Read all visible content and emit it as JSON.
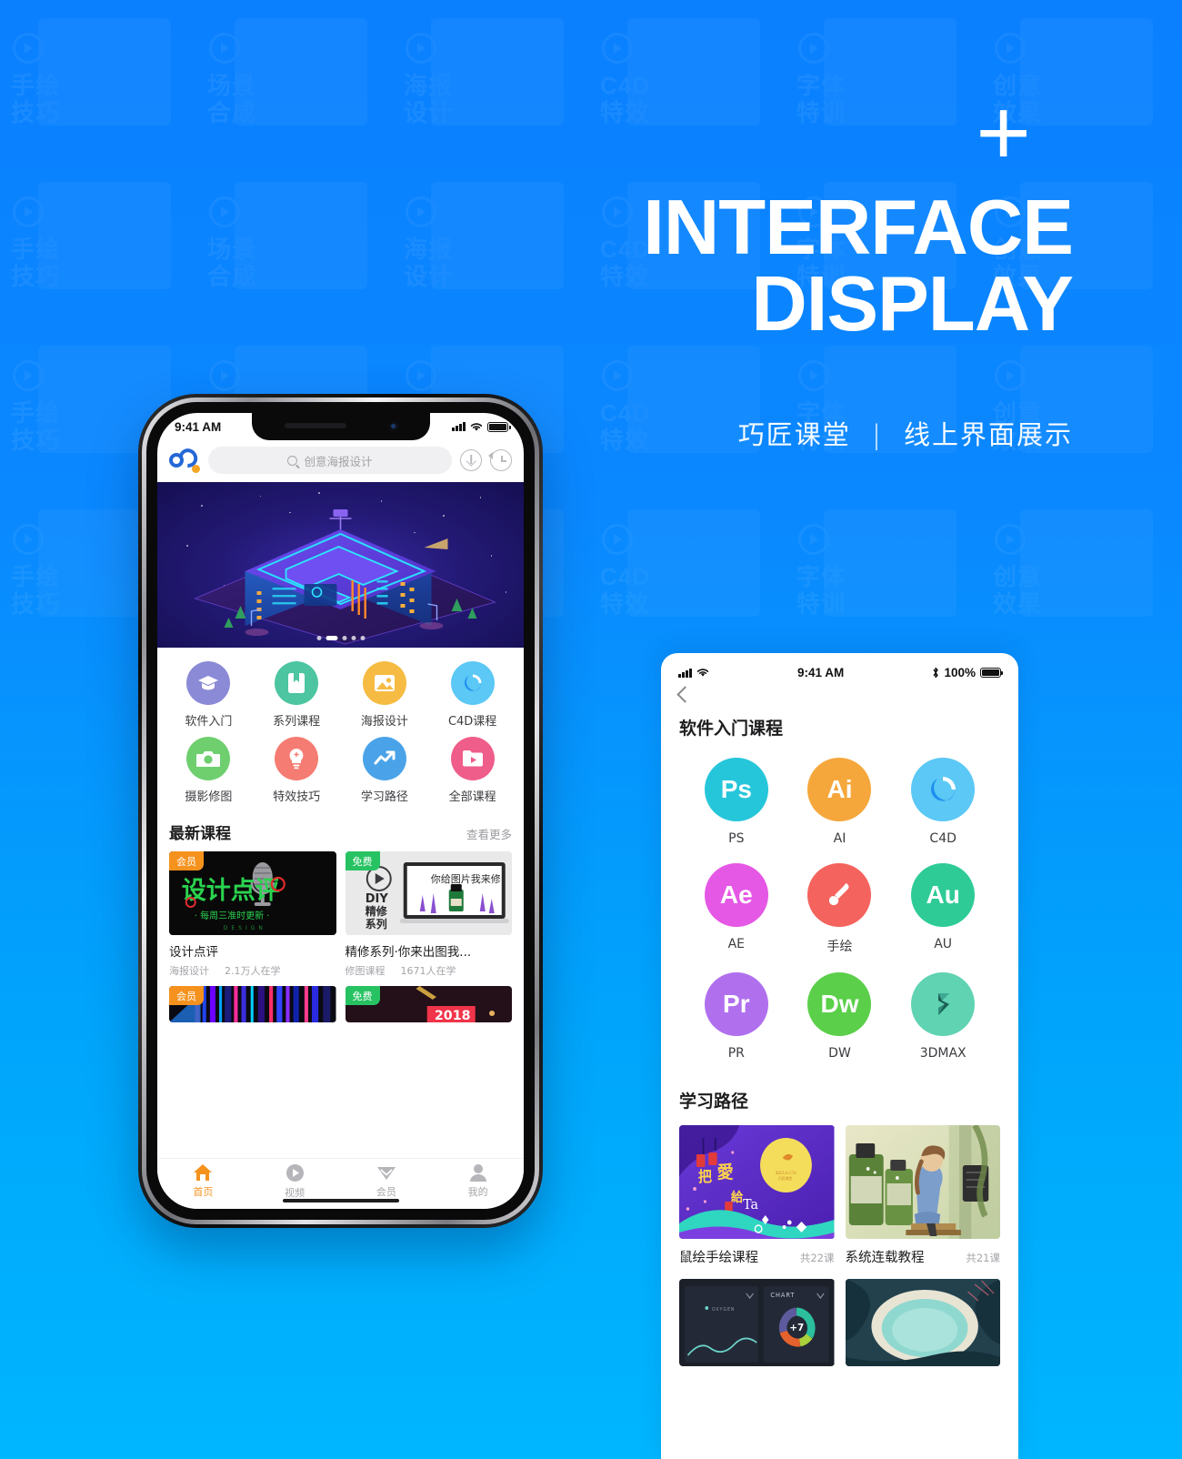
{
  "hero": {
    "plus": "+",
    "line1": "INTERFACE",
    "line2": "DISPLAY",
    "subtitle_left": "巧匠课堂",
    "subtitle_bar": "|",
    "subtitle_right": "线上界面展示"
  },
  "colors": {
    "bg_top": "#0a80ff",
    "bg_bottom": "#00b6ff",
    "accent_orange": "#f5921e",
    "accent_green": "#27c262",
    "brand_blue": "#2468d6"
  },
  "watermark_words": [
    "手绘\n技巧",
    "场景\n合成",
    "海报\n设计",
    "C4D\n特效",
    "字体\n特训",
    "创意\n效果"
  ],
  "left_phone": {
    "status": {
      "time": "9:41 AM",
      "signal": "signal-bars",
      "wifi": "wifi-icon",
      "battery": "battery-icon"
    },
    "appbar": {
      "logo": "qiaojiang-logo",
      "search_placeholder": "创意海报设计",
      "search_icon": "search-icon",
      "download_icon": "download-icon",
      "history_icon": "history-icon"
    },
    "banner": {
      "alt": "isometric-neon-building",
      "dot_count": 5,
      "active_dot": 1
    },
    "categories": [
      {
        "label": "软件入门",
        "icon": "graduation-cap-icon",
        "color": "#8b8ad6"
      },
      {
        "label": "系列课程",
        "icon": "bookmark-book-icon",
        "color": "#4cc5a0"
      },
      {
        "label": "海报设计",
        "icon": "image-icon",
        "color": "#f6bb42"
      },
      {
        "label": "C4D课程",
        "icon": "c4d-icon",
        "color": "#5bc8f5"
      },
      {
        "label": "摄影修图",
        "icon": "camera-icon",
        "color": "#6fcf6f"
      },
      {
        "label": "特效技巧",
        "icon": "lightbulb-icon",
        "color": "#f57c72"
      },
      {
        "label": "学习路径",
        "icon": "trending-up-icon",
        "color": "#4aa3e8"
      },
      {
        "label": "全部课程",
        "icon": "video-folder-icon",
        "color": "#ef5d8a"
      }
    ],
    "section": {
      "title": "最新课程",
      "more": "查看更多"
    },
    "courses": [
      {
        "tag": "会员",
        "tag_type": "vip",
        "title": "设计点评",
        "cat": "海报设计",
        "learners": "2.1万人在学",
        "thumb": "design-review-mic"
      },
      {
        "tag": "免费",
        "tag_type": "free",
        "title": "精修系列·你来出图我...",
        "cat": "修图课程",
        "learners": "1671人在学",
        "thumb": "diy-retouch-laptop"
      },
      {
        "tag": "会员",
        "tag_type": "vip",
        "title": "",
        "cat": "",
        "learners": "",
        "thumb": "color-stripes"
      },
      {
        "tag": "免费",
        "tag_type": "free",
        "title": "",
        "cat": "",
        "learners": "",
        "thumb": "dark-2018"
      }
    ],
    "tabs": [
      {
        "label": "首页",
        "icon": "home-icon",
        "active": true
      },
      {
        "label": "视频",
        "icon": "play-circle-icon",
        "active": false
      },
      {
        "label": "会员",
        "icon": "diamond-icon",
        "active": false
      },
      {
        "label": "我的",
        "icon": "person-icon",
        "active": false
      }
    ]
  },
  "right_panel": {
    "status": {
      "time": "9:41 AM",
      "battery_pct": "100%",
      "bluetooth": "bluetooth-icon"
    },
    "back_icon": "back-chevron-icon",
    "heading": "软件入门课程",
    "software": [
      {
        "name": "PS",
        "glyph": "Ps",
        "color": "#26c6da"
      },
      {
        "name": "AI",
        "glyph": "Ai",
        "color": "#f7a košt"
      },
      {
        "name": "C4D",
        "glyph": "",
        "icon": "c4d-icon",
        "color": "#5bc8f5"
      },
      {
        "name": "AE",
        "glyph": "Ae",
        "color": "#e557e5"
      },
      {
        "name": "手绘",
        "glyph": "",
        "icon": "brush-icon",
        "color": "#f4635e"
      },
      {
        "name": "AU",
        "glyph": "Au",
        "color": "#2ecb96"
      },
      {
        "name": "PR",
        "glyph": "Pr",
        "color": "#b070ee"
      },
      {
        "name": "DW",
        "glyph": "Dw",
        "color": "#5bcf4a"
      },
      {
        "name": "3DMAX",
        "glyph": "",
        "icon": "3dmax-icon",
        "color": "#5fd3b2"
      }
    ],
    "path_heading": "学习路径",
    "paths": [
      {
        "title": "鼠绘手绘课程",
        "lessons": "共22课",
        "img": "purple-moon-lantern"
      },
      {
        "title": "系统连载教程",
        "lessons": "共21课",
        "img": "watercolor-girl-bottles"
      }
    ],
    "paths_row2": [
      {
        "img": "dark-dashboard-chart",
        "chart_label": "CHART",
        "chart_value": "+7",
        "legend": "OXYGEN"
      },
      {
        "img": "aerial-lagoon"
      }
    ]
  }
}
